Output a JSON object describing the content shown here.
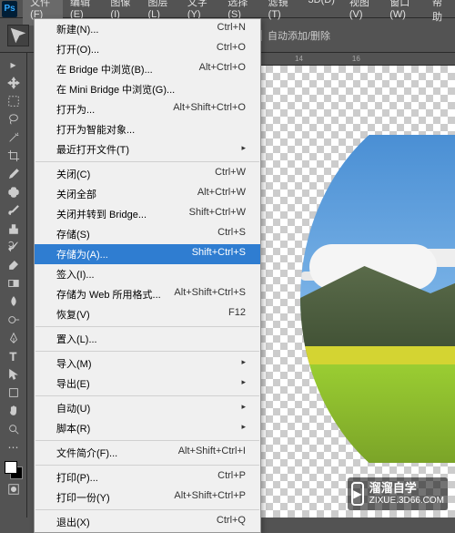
{
  "app": {
    "logo": "Ps"
  },
  "menubar": [
    {
      "label": "文件(F)",
      "active": true
    },
    {
      "label": "编辑(E)"
    },
    {
      "label": "图像(I)"
    },
    {
      "label": "图层(L)"
    },
    {
      "label": "文字(Y)"
    },
    {
      "label": "选择(S)"
    },
    {
      "label": "滤镜(T)"
    },
    {
      "label": "3D(D)"
    },
    {
      "label": "视图(V)"
    },
    {
      "label": "窗口(W)"
    },
    {
      "label": "帮助"
    }
  ],
  "options": {
    "auto_add_label": "自动添加/删除"
  },
  "ruler": {
    "marks": [
      "14",
      "16"
    ]
  },
  "dropdown": [
    {
      "label": "新建(N)...",
      "shortcut": "Ctrl+N"
    },
    {
      "label": "打开(O)...",
      "shortcut": "Ctrl+O"
    },
    {
      "label": "在 Bridge 中浏览(B)...",
      "shortcut": "Alt+Ctrl+O"
    },
    {
      "label": "在 Mini Bridge 中浏览(G)..."
    },
    {
      "label": "打开为...",
      "shortcut": "Alt+Shift+Ctrl+O"
    },
    {
      "label": "打开为智能对象..."
    },
    {
      "label": "最近打开文件(T)",
      "submenu": true
    },
    {
      "sep": true
    },
    {
      "label": "关闭(C)",
      "shortcut": "Ctrl+W"
    },
    {
      "label": "关闭全部",
      "shortcut": "Alt+Ctrl+W"
    },
    {
      "label": "关闭并转到 Bridge...",
      "shortcut": "Shift+Ctrl+W"
    },
    {
      "label": "存储(S)",
      "shortcut": "Ctrl+S"
    },
    {
      "label": "存储为(A)...",
      "shortcut": "Shift+Ctrl+S",
      "highlighted": true
    },
    {
      "label": "签入(I)..."
    },
    {
      "label": "存储为 Web 所用格式...",
      "shortcut": "Alt+Shift+Ctrl+S"
    },
    {
      "label": "恢复(V)",
      "shortcut": "F12"
    },
    {
      "sep": true
    },
    {
      "label": "置入(L)..."
    },
    {
      "sep": true
    },
    {
      "label": "导入(M)",
      "submenu": true
    },
    {
      "label": "导出(E)",
      "submenu": true
    },
    {
      "sep": true
    },
    {
      "label": "自动(U)",
      "submenu": true
    },
    {
      "label": "脚本(R)",
      "submenu": true
    },
    {
      "sep": true
    },
    {
      "label": "文件简介(F)...",
      "shortcut": "Alt+Shift+Ctrl+I"
    },
    {
      "sep": true
    },
    {
      "label": "打印(P)...",
      "shortcut": "Ctrl+P"
    },
    {
      "label": "打印一份(Y)",
      "shortcut": "Alt+Shift+Ctrl+P"
    },
    {
      "sep": true
    },
    {
      "label": "退出(X)",
      "shortcut": "Ctrl+Q"
    }
  ],
  "watermark": {
    "title": "溜溜自学",
    "url": "ZIXUE.3D66.COM"
  }
}
